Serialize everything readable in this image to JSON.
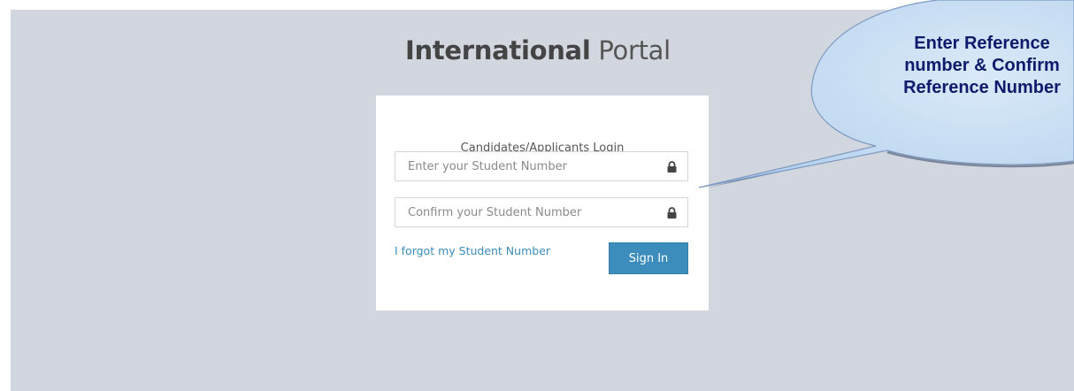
{
  "header": {
    "title_bold": "International",
    "title_light": " Portal"
  },
  "login": {
    "heading": "Candidates/Applicants Login",
    "student_number": {
      "value": "",
      "placeholder": "Enter your Student Number",
      "icon": "lock-icon"
    },
    "confirm_student_number": {
      "value": "",
      "placeholder": "Confirm your Student Number",
      "icon": "lock-icon"
    },
    "forgot_link": "I forgot my Student Number",
    "sign_in_label": "Sign In"
  },
  "callout": {
    "line1": "Enter Reference",
    "line2": "number & Confirm",
    "line3": "Reference Number"
  },
  "colors": {
    "background": "#d2d6de",
    "accent": "#3c8dbc",
    "callout_text": "#0e1a6b"
  }
}
